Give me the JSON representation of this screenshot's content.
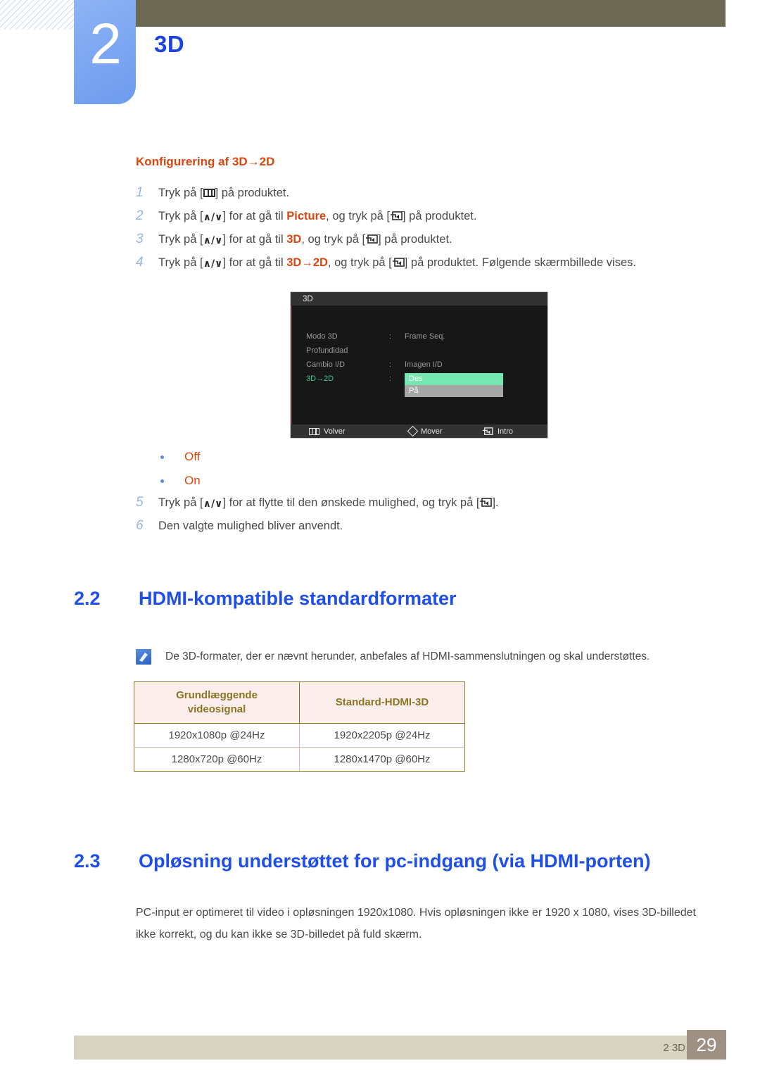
{
  "chapter": {
    "number": "2",
    "title": "3D"
  },
  "subsection": {
    "heading": "Konfigurering af 3D→2D",
    "steps": [
      {
        "num": "1",
        "pre": "Tryk på [",
        "icon": "menu-key-icon",
        "post": "] på produktet.",
        "parts": [
          "Tryk på [",
          "] på produktet."
        ]
      },
      {
        "num": "2",
        "t1": "Tryk på [",
        "t2": "] for at gå til ",
        "hl": "Picture",
        "t3": ", og tryk på [",
        "t4": "] på produktet."
      },
      {
        "num": "3",
        "t1": "Tryk på [",
        "t2": "] for at gå til ",
        "hl": "3D",
        "t3": ", og tryk på [",
        "t4": "] på produktet."
      },
      {
        "num": "4",
        "t1": "Tryk på [",
        "t2": "] for at gå til ",
        "hl": "3D→2D",
        "t3": ", og tryk på [",
        "t4": "] på produktet. Følgende skærmbillede vises."
      },
      {
        "num": "5",
        "t1": "Tryk på [",
        "t2": "] for at flytte til den ønskede mulighed, og tryk på [",
        "t3": "]."
      },
      {
        "num": "6",
        "t1": "Den valgte mulighed bliver anvendt."
      }
    ],
    "arrow_keys_label": "∧/∨",
    "bullets": [
      {
        "label": "Off"
      },
      {
        "label": "On"
      }
    ]
  },
  "osd": {
    "title": "3D",
    "rows": [
      {
        "label": "Modo 3D",
        "colon": ":",
        "value": "Frame Seq."
      },
      {
        "label": "Profundidad",
        "colon": "",
        "value": ""
      },
      {
        "label": "Cambio I/D",
        "colon": ":",
        "value": "Imagen I/D"
      },
      {
        "label": "3D→2D",
        "colon": ":",
        "value": ""
      }
    ],
    "options": [
      {
        "label": "Des",
        "state": "highlighted"
      },
      {
        "label": "På",
        "state": "normal"
      }
    ],
    "footer": [
      {
        "icon": "menu-icon",
        "label": "Volver"
      },
      {
        "icon": "diamond-icon",
        "label": "Mover"
      },
      {
        "icon": "enter-icon",
        "label": "Intro"
      }
    ]
  },
  "section_22": {
    "number": "2.2",
    "title": "HDMI-kompatible standardformater",
    "note": "De 3D-formater, der er nævnt herunder, anbefales af HDMI-sammenslutningen og skal understøttes.",
    "table": {
      "type": "table",
      "headers": [
        "Grundlæggende videosignal",
        "Standard-HDMI-3D"
      ],
      "header_line1": "Grundlæggende",
      "header_line2": "videosignal",
      "rows": [
        [
          "1920x1080p @24Hz",
          "1920x2205p @24Hz"
        ],
        [
          "1280x720p @60Hz",
          "1280x1470p @60Hz"
        ]
      ]
    }
  },
  "section_23": {
    "number": "2.3",
    "title": "Opløsning understøttet for pc-indgang (via HDMI-porten)",
    "paragraph": "PC-input er optimeret til video i opløsningen 1920x1080. Hvis opløsningen ikke er 1920 x 1080, vises 3D-billedet ikke korrekt, og du kan ikke se 3D-billedet på fuld skærm."
  },
  "footer": {
    "label": "2 3D",
    "page": "29"
  },
  "colors": {
    "chapter_tab": "#7ea8f2",
    "olive_band": "#6b6954",
    "heading_blue": "#1f4fe8",
    "accent_orange": "#d9470f",
    "table_header_text": "#8a7524",
    "table_header_bg": "#fdeeee",
    "footer_band": "#d8d2c1",
    "page_box": "#9e9184",
    "osd_highlight": "#74e8b0"
  }
}
